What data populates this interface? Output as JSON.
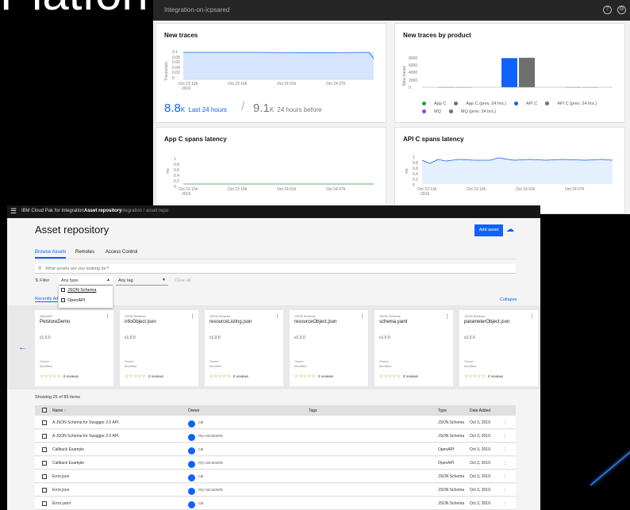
{
  "background_title": "Platform",
  "dashboard": {
    "crumb": "Integration",
    "crumb_extra": "-on-icpsared",
    "help_icon": "help-icon",
    "settings_icon": "settings-icon",
    "new_traces": {
      "title": "New traces",
      "ylabel": "Traces/sec",
      "yticks": [
        "0.1",
        "0.08",
        "0.06",
        "0.04",
        "0.02",
        "0"
      ],
      "xticks": [
        "Oct 23 13h",
        "Oct 23 19h",
        "Oct 24 01h",
        "Oct 24 07h"
      ],
      "xyear": "2019",
      "value_now": "8.8",
      "unit_now": "K",
      "label_now": "Last 24 hours",
      "value_before": "9.1",
      "unit_before": "K",
      "label_before": "24 hours before"
    },
    "traces_by_product": {
      "title": "New traces by product",
      "ylabel": "New traces",
      "yticks": [
        "8000",
        "6000",
        "4000",
        "2000",
        "0"
      ],
      "legend": [
        {
          "label": "App C",
          "color": "#24a148"
        },
        {
          "label": "App C (prev. 24 hrs.)",
          "color": "#6f6f6f"
        },
        {
          "label": "API C",
          "color": "#0f62fe"
        },
        {
          "label": "API C (prev. 24 hrs.)",
          "color": "#6f6f6f"
        },
        {
          "label": "MQ",
          "color": "#8a3ffc"
        },
        {
          "label": "MQ (prev. 24 hrs.)",
          "color": "#6f6f6f"
        }
      ]
    },
    "app_latency": {
      "title": "App C spans latency",
      "ylabel": "ms",
      "yticks": [
        "1",
        "0.8",
        "0.6",
        "0.4",
        "0.2",
        "0"
      ],
      "xticks": [
        "Oct 23 13h",
        "Oct 23 19h",
        "Oct 24 01h",
        "Oct 24 07h"
      ],
      "xyear": "2019"
    },
    "api_latency": {
      "title": "API C spans latency",
      "ylabel": "ms",
      "yticks": [
        "1",
        "0.8",
        "0.6",
        "0.4",
        "0.2",
        "0"
      ],
      "xticks": [
        "Oct 23 13h",
        "Oct 23 19h",
        "Oct 24 01h",
        "Oct 24 07h"
      ],
      "xyear": "2019"
    }
  },
  "chart_data": [
    {
      "type": "bar",
      "title": "New traces by product",
      "ylabel": "New traces",
      "ylim": [
        0,
        9000
      ],
      "categories": [
        "App C",
        "API C",
        "MQ"
      ],
      "series": [
        {
          "name": "Last 24 hrs.",
          "values": [
            0,
            8700,
            0
          ]
        },
        {
          "name": "prev. 24 hrs.",
          "values": [
            0,
            8800,
            0
          ]
        }
      ]
    }
  ],
  "asset": {
    "topbar": {
      "menu": "☰",
      "brand": "IBM Cloud Pak for Integration",
      "current": "Asset repository",
      "env": "integration / asset repo"
    },
    "title": "Asset repository",
    "add_button": "Add asset",
    "tabs": [
      "Browse Assets",
      "Remotes",
      "Access Control"
    ],
    "search_placeholder": "What assets are you looking for?",
    "filter_label": "Filter",
    "type_select": "Any type",
    "tag_select": "Any tag",
    "clear_all": "Clear all",
    "dropdown_options": [
      "JSON Schema",
      "OpenAPI"
    ],
    "recent_label": "Recently Ad",
    "collapse": "Collapse",
    "cards": [
      {
        "type": "OpenAPI",
        "name": "PetstoreDemo",
        "version": "v1.0.0",
        "owner": "Owner:",
        "modified": "Modified:",
        "reviews": "0 reviews"
      },
      {
        "type": "JSON Schema",
        "name": "infoObject.json",
        "version": "v1.0.0",
        "owner": "Owner:",
        "modified": "Modified:",
        "reviews": "0 reviews"
      },
      {
        "type": "JSON Schema",
        "name": "resourceListing.json",
        "version": "v1.0.0",
        "owner": "Owner:",
        "modified": "Modified:",
        "reviews": "0 reviews"
      },
      {
        "type": "JSON Schema",
        "name": "resourceObject.json",
        "version": "v1.0.0",
        "owner": "Owner:",
        "modified": "Modified:",
        "reviews": "0 reviews"
      },
      {
        "type": "JSON Schema",
        "name": "schema.yaml",
        "version": "v1.0.0",
        "owner": "Owner:",
        "modified": "Modified:",
        "reviews": "0 reviews"
      },
      {
        "type": "JSON Schema",
        "name": "parameterObject.json",
        "version": "v1.0.0",
        "owner": "Owner:",
        "modified": "Modified:",
        "reviews": "0 reviews"
      }
    ],
    "stars": "☆☆☆☆☆",
    "showing": "Showing 25 of 85 items",
    "columns": [
      "Name ↑",
      "Owner",
      "Tags",
      "Type",
      "Date Added"
    ],
    "rows": [
      {
        "name": "A JSON Schema for Swagger 2.0 API.",
        "owner": "cai",
        "type": "JSON Schema",
        "date": "Oct 3, 2019"
      },
      {
        "name": "A JSON Schema for Swagger 2.0 API.",
        "owner": "my-cai-assets",
        "type": "JSON Schema",
        "date": "Oct 3, 2019"
      },
      {
        "name": "Callback Example",
        "owner": "cai",
        "type": "OpenAPI",
        "date": "Oct 3, 2019"
      },
      {
        "name": "Callback Example",
        "owner": "my-cai-assets",
        "type": "OpenAPI",
        "date": "Oct 3, 2019"
      },
      {
        "name": "Error.json",
        "owner": "cai",
        "type": "JSON Schema",
        "date": "Oct 3, 2019"
      },
      {
        "name": "Error.json",
        "owner": "my-cai-assets",
        "type": "JSON Schema",
        "date": "Oct 3, 2019"
      },
      {
        "name": "Error.yaml",
        "owner": "cai",
        "type": "JSON Schema",
        "date": "Oct 3, 2019"
      }
    ]
  }
}
